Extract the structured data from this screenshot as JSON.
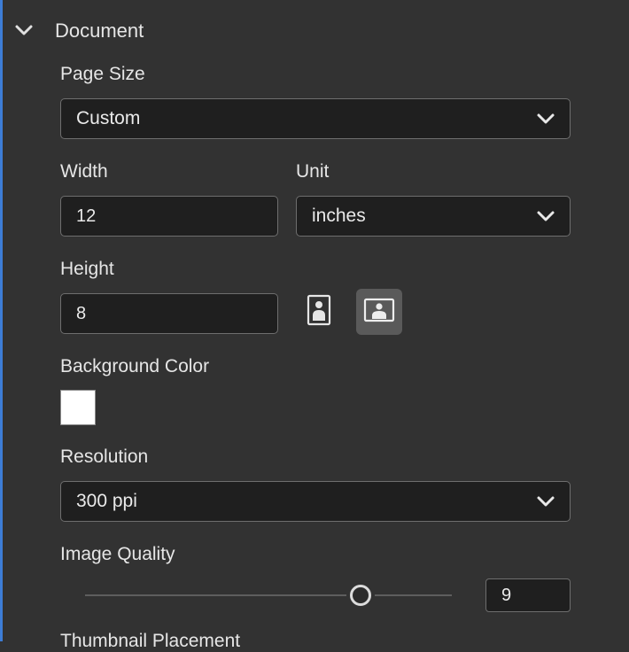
{
  "section": {
    "title": "Document",
    "expanded": true
  },
  "page_size": {
    "label": "Page Size",
    "value": "Custom"
  },
  "width": {
    "label": "Width",
    "value": "12"
  },
  "unit": {
    "label": "Unit",
    "value": "inches"
  },
  "height": {
    "label": "Height",
    "value": "8"
  },
  "orientation": {
    "options": [
      "portrait",
      "landscape"
    ],
    "selected": "landscape"
  },
  "background_color": {
    "label": "Background Color",
    "value": "#ffffff"
  },
  "resolution": {
    "label": "Resolution",
    "value": "300 ppi"
  },
  "image_quality": {
    "label": "Image Quality",
    "value": "9",
    "max": 12
  },
  "next_section": {
    "label": "Thumbnail Placement"
  },
  "colors": {
    "panel_bg": "#323232",
    "field_bg": "#1f1f1f",
    "accent": "#3d7dd6",
    "selected_toggle": "#5a5a5a"
  }
}
